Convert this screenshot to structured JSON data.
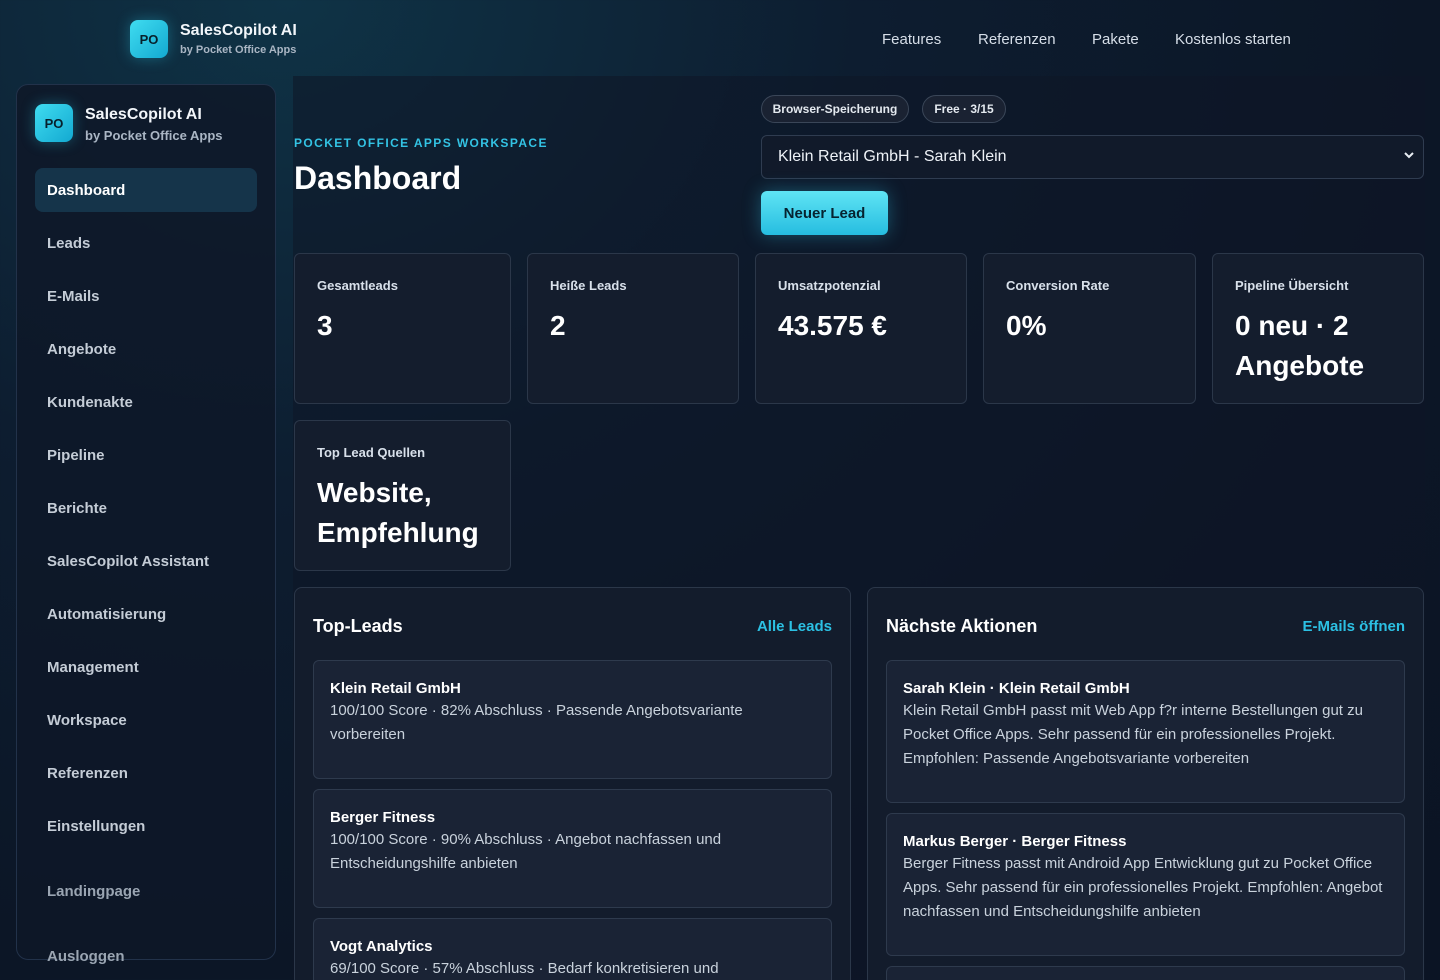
{
  "brand": {
    "logo_text": "PO",
    "title": "SalesCopilot AI",
    "subtitle": "by Pocket Office Apps"
  },
  "topnav": {
    "links": [
      "Features",
      "Referenzen",
      "Pakete",
      "Kostenlos starten"
    ]
  },
  "sidebar": {
    "brand": {
      "logo_text": "PO",
      "title": "SalesCopilot AI",
      "subtitle": "by Pocket Office Apps"
    },
    "items": [
      {
        "label": "Dashboard"
      },
      {
        "label": "Leads"
      },
      {
        "label": "E-Mails"
      },
      {
        "label": "Angebote"
      },
      {
        "label": "Kundenakte"
      },
      {
        "label": "Pipeline"
      },
      {
        "label": "Berichte"
      },
      {
        "label": "SalesCopilot Assistant"
      },
      {
        "label": "Automatisierung"
      },
      {
        "label": "Management"
      },
      {
        "label": "Workspace"
      },
      {
        "label": "Referenzen"
      },
      {
        "label": "Einstellungen"
      }
    ],
    "footer_items": [
      {
        "label": "Landingpage"
      },
      {
        "label": "Ausloggen"
      }
    ]
  },
  "header": {
    "eyebrow": "POCKET OFFICE APPS WORKSPACE",
    "title": "Dashboard",
    "pill_storage": "Browser-Speicherung",
    "pill_plan": "Free · 3/15",
    "select_value": "Klein Retail GmbH - Sarah Klein",
    "new_lead_button": "Neuer Lead"
  },
  "stats": [
    {
      "label": "Gesamtleads",
      "value": "3"
    },
    {
      "label": "Heiße Leads",
      "value": "2"
    },
    {
      "label": "Umsatzpotenzial",
      "value": "43.575 €"
    },
    {
      "label": "Conversion Rate",
      "value": "0%"
    },
    {
      "label": "Pipeline Übersicht",
      "value": "0 neu · 2 Angebote"
    },
    {
      "label": "Top Lead Quellen",
      "value": "Website, Empfehlung"
    }
  ],
  "top_leads": {
    "title": "Top-Leads",
    "link": "Alle Leads",
    "items": [
      {
        "title": "Klein Retail GmbH",
        "text": "100/100 Score · 82% Abschluss · Passende Angebotsvariante vorbereiten"
      },
      {
        "title": "Berger Fitness",
        "text": "100/100 Score · 90% Abschluss · Angebot nachfassen und Entscheidungshilfe anbieten"
      },
      {
        "title": "Vogt Analytics",
        "text": "69/100 Score · 57% Abschluss · Bedarf konkretisieren und"
      }
    ]
  },
  "next_actions": {
    "title": "Nächste Aktionen",
    "link": "E-Mails öffnen",
    "items": [
      {
        "title": "Sarah Klein · Klein Retail GmbH",
        "text": "Klein Retail GmbH passt mit Web App f?r interne Bestellungen gut zu Pocket Office Apps. Sehr passend für ein professionelles Projekt. Empfohlen: Passende Angebotsvariante vorbereiten"
      },
      {
        "title": "Markus Berger · Berger Fitness",
        "text": "Berger Fitness passt mit Android App Entwicklung gut zu Pocket Office Apps. Sehr passend für ein professionelles Projekt. Empfohlen: Angebot nachfassen und Entscheidungshilfe anbieten"
      }
    ]
  }
}
